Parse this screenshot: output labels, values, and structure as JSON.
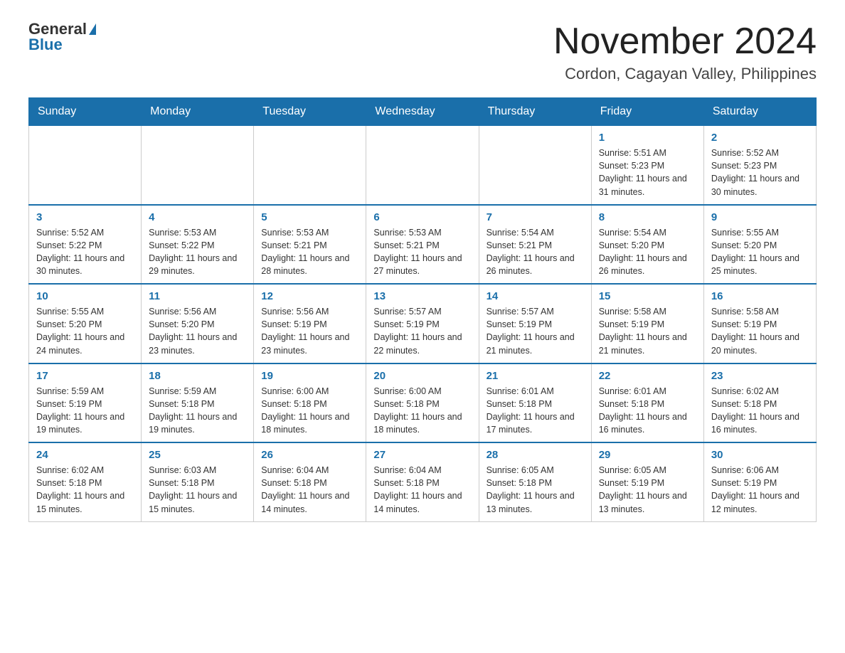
{
  "header": {
    "logo_general": "General",
    "logo_blue": "Blue",
    "month_title": "November 2024",
    "location": "Cordon, Cagayan Valley, Philippines"
  },
  "days_of_week": [
    "Sunday",
    "Monday",
    "Tuesday",
    "Wednesday",
    "Thursday",
    "Friday",
    "Saturday"
  ],
  "weeks": [
    [
      {
        "day": "",
        "info": ""
      },
      {
        "day": "",
        "info": ""
      },
      {
        "day": "",
        "info": ""
      },
      {
        "day": "",
        "info": ""
      },
      {
        "day": "",
        "info": ""
      },
      {
        "day": "1",
        "info": "Sunrise: 5:51 AM\nSunset: 5:23 PM\nDaylight: 11 hours and 31 minutes."
      },
      {
        "day": "2",
        "info": "Sunrise: 5:52 AM\nSunset: 5:23 PM\nDaylight: 11 hours and 30 minutes."
      }
    ],
    [
      {
        "day": "3",
        "info": "Sunrise: 5:52 AM\nSunset: 5:22 PM\nDaylight: 11 hours and 30 minutes."
      },
      {
        "day": "4",
        "info": "Sunrise: 5:53 AM\nSunset: 5:22 PM\nDaylight: 11 hours and 29 minutes."
      },
      {
        "day": "5",
        "info": "Sunrise: 5:53 AM\nSunset: 5:21 PM\nDaylight: 11 hours and 28 minutes."
      },
      {
        "day": "6",
        "info": "Sunrise: 5:53 AM\nSunset: 5:21 PM\nDaylight: 11 hours and 27 minutes."
      },
      {
        "day": "7",
        "info": "Sunrise: 5:54 AM\nSunset: 5:21 PM\nDaylight: 11 hours and 26 minutes."
      },
      {
        "day": "8",
        "info": "Sunrise: 5:54 AM\nSunset: 5:20 PM\nDaylight: 11 hours and 26 minutes."
      },
      {
        "day": "9",
        "info": "Sunrise: 5:55 AM\nSunset: 5:20 PM\nDaylight: 11 hours and 25 minutes."
      }
    ],
    [
      {
        "day": "10",
        "info": "Sunrise: 5:55 AM\nSunset: 5:20 PM\nDaylight: 11 hours and 24 minutes."
      },
      {
        "day": "11",
        "info": "Sunrise: 5:56 AM\nSunset: 5:20 PM\nDaylight: 11 hours and 23 minutes."
      },
      {
        "day": "12",
        "info": "Sunrise: 5:56 AM\nSunset: 5:19 PM\nDaylight: 11 hours and 23 minutes."
      },
      {
        "day": "13",
        "info": "Sunrise: 5:57 AM\nSunset: 5:19 PM\nDaylight: 11 hours and 22 minutes."
      },
      {
        "day": "14",
        "info": "Sunrise: 5:57 AM\nSunset: 5:19 PM\nDaylight: 11 hours and 21 minutes."
      },
      {
        "day": "15",
        "info": "Sunrise: 5:58 AM\nSunset: 5:19 PM\nDaylight: 11 hours and 21 minutes."
      },
      {
        "day": "16",
        "info": "Sunrise: 5:58 AM\nSunset: 5:19 PM\nDaylight: 11 hours and 20 minutes."
      }
    ],
    [
      {
        "day": "17",
        "info": "Sunrise: 5:59 AM\nSunset: 5:19 PM\nDaylight: 11 hours and 19 minutes."
      },
      {
        "day": "18",
        "info": "Sunrise: 5:59 AM\nSunset: 5:18 PM\nDaylight: 11 hours and 19 minutes."
      },
      {
        "day": "19",
        "info": "Sunrise: 6:00 AM\nSunset: 5:18 PM\nDaylight: 11 hours and 18 minutes."
      },
      {
        "day": "20",
        "info": "Sunrise: 6:00 AM\nSunset: 5:18 PM\nDaylight: 11 hours and 18 minutes."
      },
      {
        "day": "21",
        "info": "Sunrise: 6:01 AM\nSunset: 5:18 PM\nDaylight: 11 hours and 17 minutes."
      },
      {
        "day": "22",
        "info": "Sunrise: 6:01 AM\nSunset: 5:18 PM\nDaylight: 11 hours and 16 minutes."
      },
      {
        "day": "23",
        "info": "Sunrise: 6:02 AM\nSunset: 5:18 PM\nDaylight: 11 hours and 16 minutes."
      }
    ],
    [
      {
        "day": "24",
        "info": "Sunrise: 6:02 AM\nSunset: 5:18 PM\nDaylight: 11 hours and 15 minutes."
      },
      {
        "day": "25",
        "info": "Sunrise: 6:03 AM\nSunset: 5:18 PM\nDaylight: 11 hours and 15 minutes."
      },
      {
        "day": "26",
        "info": "Sunrise: 6:04 AM\nSunset: 5:18 PM\nDaylight: 11 hours and 14 minutes."
      },
      {
        "day": "27",
        "info": "Sunrise: 6:04 AM\nSunset: 5:18 PM\nDaylight: 11 hours and 14 minutes."
      },
      {
        "day": "28",
        "info": "Sunrise: 6:05 AM\nSunset: 5:18 PM\nDaylight: 11 hours and 13 minutes."
      },
      {
        "day": "29",
        "info": "Sunrise: 6:05 AM\nSunset: 5:19 PM\nDaylight: 11 hours and 13 minutes."
      },
      {
        "day": "30",
        "info": "Sunrise: 6:06 AM\nSunset: 5:19 PM\nDaylight: 11 hours and 12 minutes."
      }
    ]
  ]
}
